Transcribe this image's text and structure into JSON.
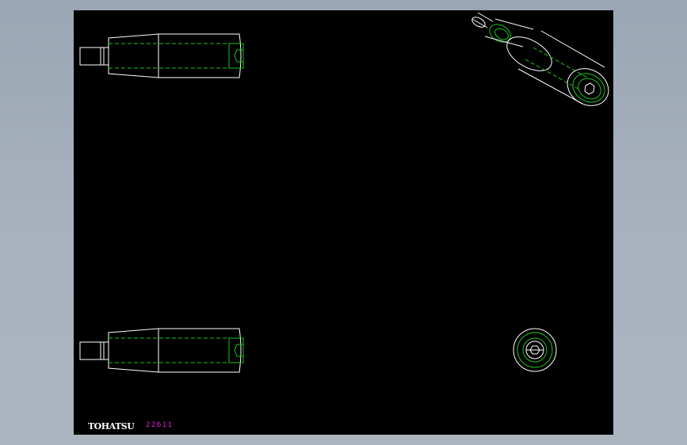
{
  "drawing": {
    "brand_label": "TOHATSU",
    "part_code": "22611"
  },
  "colors": {
    "workspace": "#a9b3bf",
    "viewport": "#000000",
    "outline": "#ffffff",
    "hidden_line": "#19c619",
    "code_text": "#e020e0"
  }
}
